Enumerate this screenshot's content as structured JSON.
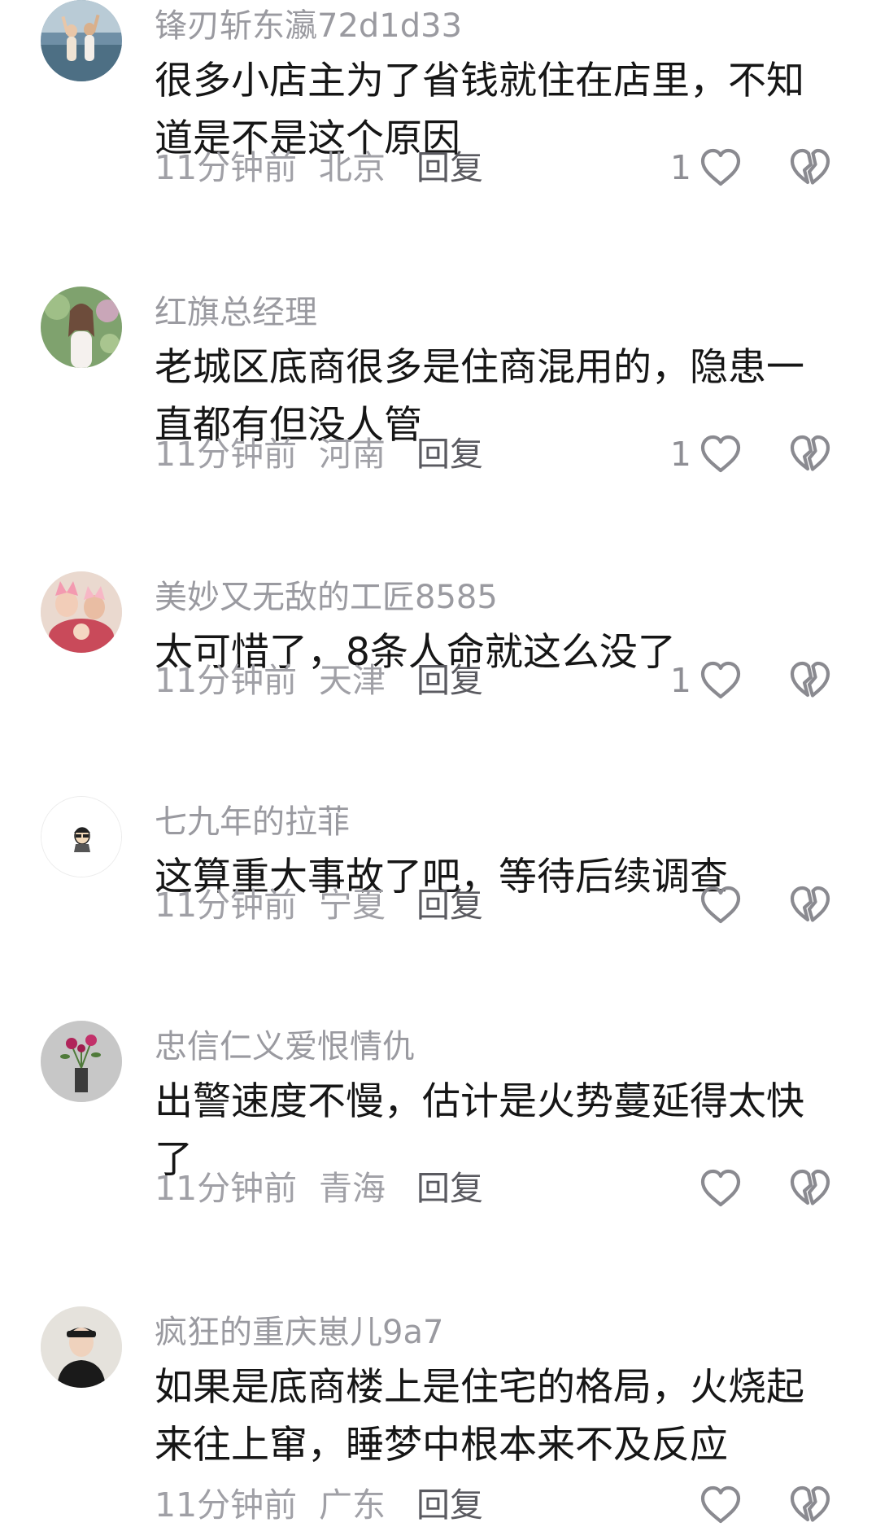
{
  "comments": [
    {
      "username": "锋刃斩东瀛72d1d33",
      "text": "很多小店主为了省钱就住在店里，不知道是不是这个原因",
      "time": "11分钟前",
      "location": "北京",
      "reply_label": "回复",
      "likes": "1",
      "avatar_icon": "avatar-photo-two-people-waterside"
    },
    {
      "username": "红旗总经理",
      "text": "老城区底商很多是住商混用的，隐患一直都有但没人管",
      "time": "11分钟前",
      "location": "河南",
      "reply_label": "回复",
      "likes": "1",
      "avatar_icon": "avatar-photo-woman-garden"
    },
    {
      "username": "美妙又无敌的工匠8585",
      "text": "太可惜了，8条人命就这么没了",
      "time": "11分钟前",
      "location": "天津",
      "reply_label": "回复",
      "likes": "1",
      "avatar_icon": "avatar-photo-group-selfie"
    },
    {
      "username": "七九年的拉菲",
      "text": "这算重大事故了吧，等待后续调查",
      "time": "11分钟前",
      "location": "宁夏",
      "reply_label": "回复",
      "likes": "",
      "avatar_icon": "avatar-cartoon-face"
    },
    {
      "username": "忠信仁义爱恨情仇",
      "text": "出警速度不慢，估计是火势蔓延得太快了",
      "time": "11分钟前",
      "location": "青海",
      "reply_label": "回复",
      "likes": "",
      "avatar_icon": "avatar-photo-flowers-vase"
    },
    {
      "username": "疯狂的重庆崽儿9a7",
      "text": "如果是底商楼上是住宅的格局，火烧起来往上窜，睡梦中根本来不及反应",
      "time": "11分钟前",
      "location": "广东",
      "reply_label": "回复",
      "likes": "",
      "avatar_icon": "avatar-photo-man-cap"
    }
  ],
  "colors": {
    "username": "#9a9aa0",
    "text": "#161616",
    "meta": "#a0a0a6",
    "reply": "#5a5a60",
    "icon_stroke": "#8a8a90"
  }
}
